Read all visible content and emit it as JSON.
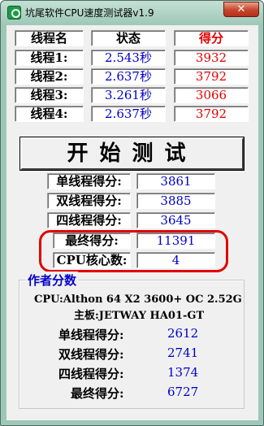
{
  "window": {
    "title": "坑尾软件CPU速度测试器v1.9",
    "close_glyph": "✕"
  },
  "header": {
    "thread_name": "线程名",
    "status": "状态",
    "score": "得分"
  },
  "threads": [
    {
      "name": "线程1:",
      "time": "2.543秒",
      "score": "3932"
    },
    {
      "name": "线程2:",
      "time": "2.637秒",
      "score": "3792"
    },
    {
      "name": "线程3:",
      "time": "3.261秒",
      "score": "3066"
    },
    {
      "name": "线程4:",
      "time": "2.637秒",
      "score": "3792"
    }
  ],
  "start_button": "开始测试",
  "results": {
    "single_label": "单线程得分:",
    "single_value": "3861",
    "dual_label": "双线程得分:",
    "dual_value": "3885",
    "quad_label": "四线程得分:",
    "quad_value": "3645",
    "final_label": "最终得分:",
    "final_value": "11391",
    "cores_label": "CPU核心数:",
    "cores_value": "4"
  },
  "author": {
    "legend": "作者分数",
    "cpu_line": "CPU:Althon 64 X2 3600+ OC 2.52G",
    "board_line": "主板:JETWAY HA01-GT",
    "single_label": "单线程得分:",
    "single_value": "2612",
    "dual_label": "双线程得分:",
    "dual_value": "2741",
    "quad_label": "四线程得分:",
    "quad_value": "1374",
    "final_label": "最终得分:",
    "final_value": "6727"
  },
  "colors": {
    "frame": "#9ec7b7",
    "accent_blue": "#0000c8",
    "accent_red": "#e00000",
    "close_button": "#c6452b"
  }
}
